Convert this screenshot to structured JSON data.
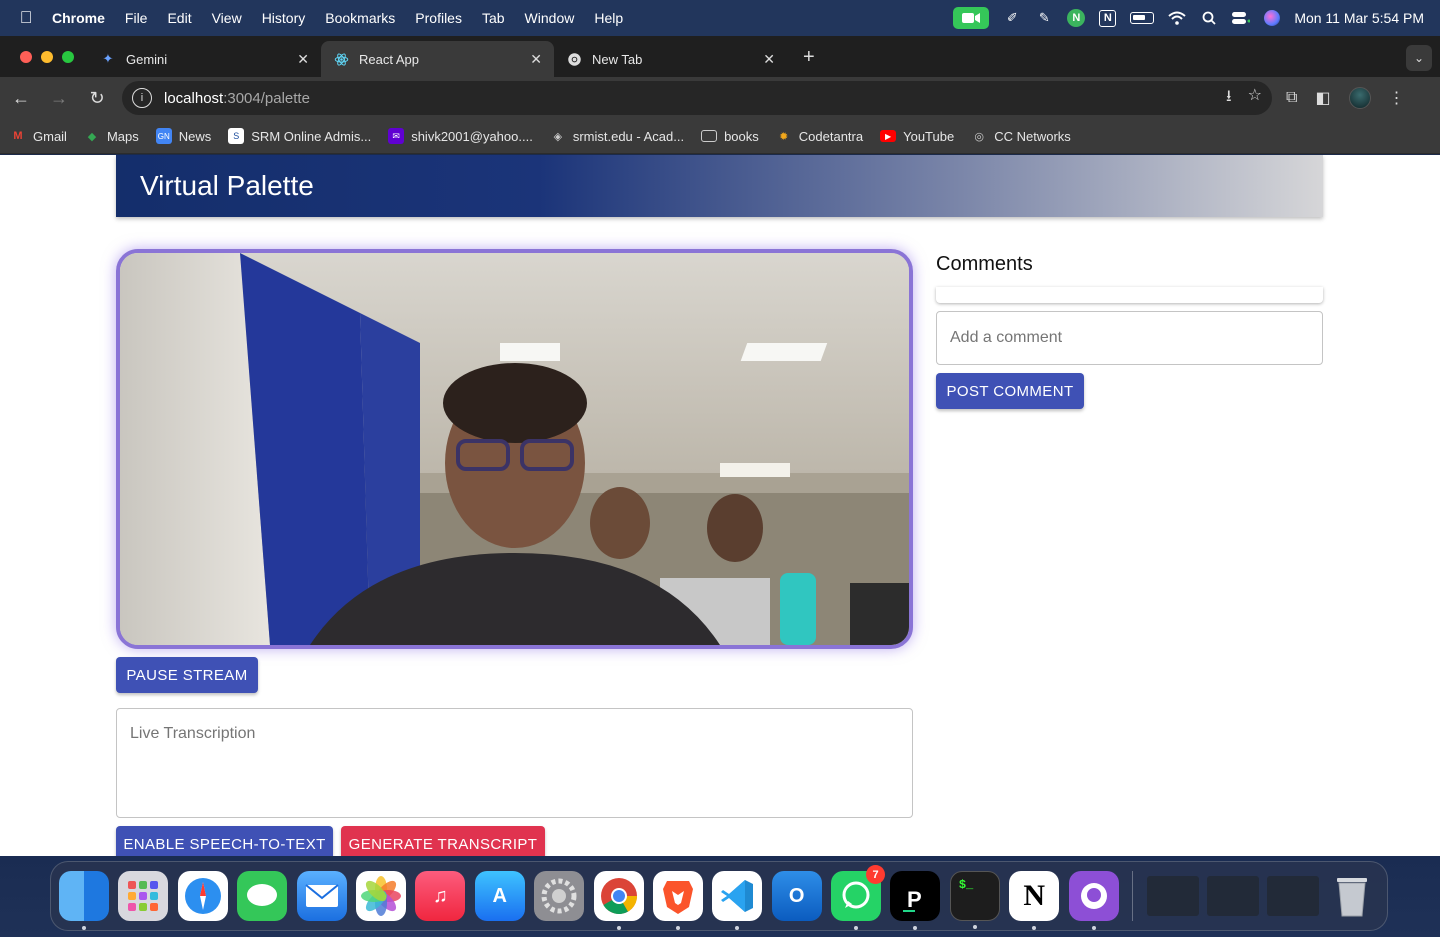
{
  "menubar": {
    "app_name": "Chrome",
    "items": [
      "File",
      "Edit",
      "View",
      "History",
      "Bookmarks",
      "Profiles",
      "Tab",
      "Window",
      "Help"
    ],
    "clock": "Mon 11 Mar  5:54 PM"
  },
  "tabs": [
    {
      "title": "Gemini",
      "icon": "gemini-icon",
      "active": false
    },
    {
      "title": "React App",
      "icon": "react-icon",
      "active": true
    },
    {
      "title": "New Tab",
      "icon": "chrome-icon",
      "active": false
    }
  ],
  "address_bar": {
    "host": "localhost",
    "path": ":3004/palette"
  },
  "bookmarks": [
    {
      "label": "Gmail",
      "icon": "gmail-icon"
    },
    {
      "label": "Maps",
      "icon": "maps-icon"
    },
    {
      "label": "News",
      "icon": "news-icon"
    },
    {
      "label": "SRM Online Admis...",
      "icon": "srm-icon"
    },
    {
      "label": "shivk2001@yahoo....",
      "icon": "yahoo-mail-icon"
    },
    {
      "label": "srmist.edu - Acad...",
      "icon": "srmist-icon"
    },
    {
      "label": "books",
      "icon": "folder-icon"
    },
    {
      "label": "Codetantra",
      "icon": "codetantra-icon"
    },
    {
      "label": "YouTube",
      "icon": "youtube-icon"
    },
    {
      "label": "CC Networks",
      "icon": "globe-icon"
    }
  ],
  "app": {
    "title": "Virtual Palette",
    "pause_button": "PAUSE STREAM",
    "transcription_placeholder": "Live Transcription",
    "speech_button": "ENABLE SPEECH-TO-TEXT",
    "transcript_button": "GENERATE TRANSCRIPT",
    "comments_title": "Comments",
    "comment_placeholder": "Add a comment",
    "post_button": "POST COMMENT"
  },
  "dock": {
    "apps": [
      "finder",
      "launchpad",
      "safari",
      "messages",
      "mail",
      "photos",
      "music",
      "app-store",
      "system-settings",
      "chrome",
      "brave",
      "vscode",
      "outlook",
      "whatsapp",
      "pycharm",
      "terminal",
      "notion",
      "github-desktop"
    ],
    "whatsapp_badge": "7"
  }
}
